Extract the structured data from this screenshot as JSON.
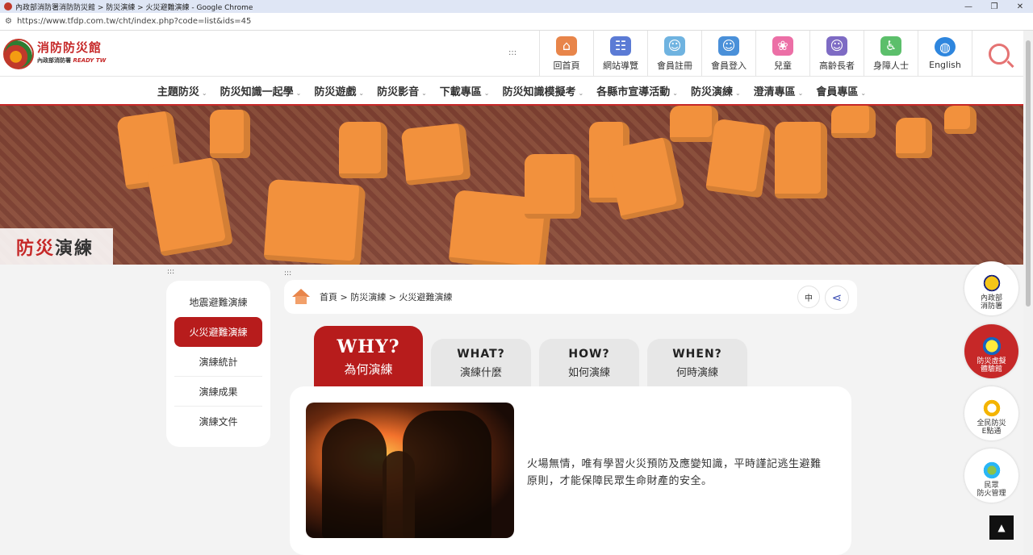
{
  "browser": {
    "window_title": "內政部消防署消防防災館 > 防災演練 > 火災避難演練 - Google Chrome",
    "url": "https://www.tfdp.com.tw/cht/index.php?code=list&ids=45",
    "controls": {
      "minimize": "—",
      "restore": "❐",
      "close": "✕"
    }
  },
  "site": {
    "logo_name": "消防防災館",
    "logo_sub": "內政部消防署",
    "logo_tag": "READY TW",
    "accessibility_mark": ":::"
  },
  "topnav": [
    {
      "label": "回首頁",
      "icon": "home-icon",
      "color": "#e8854a",
      "glyph": "⌂"
    },
    {
      "label": "網站導覽",
      "icon": "sitemap-icon",
      "color": "#5b7bd5",
      "glyph": "☷"
    },
    {
      "label": "會員註冊",
      "icon": "register-icon",
      "color": "#6fb3e0",
      "glyph": "☺"
    },
    {
      "label": "會員登入",
      "icon": "login-icon",
      "color": "#4a90d9",
      "glyph": "☺"
    },
    {
      "label": "兒童",
      "icon": "bear-icon",
      "color": "#ec6fa6",
      "glyph": "❀"
    },
    {
      "label": "高齡長者",
      "icon": "elder-icon",
      "color": "#7e6bc4",
      "glyph": "☺"
    },
    {
      "label": "身障人士",
      "icon": "wheelchair-icon",
      "color": "#5cbf6b",
      "glyph": "♿"
    },
    {
      "label": "English",
      "icon": "globe-icon",
      "color": "#2e86de",
      "glyph": "◍"
    }
  ],
  "mainmenu": [
    "主題防災",
    "防災知識一起學",
    "防災遊戲",
    "防災影音",
    "下載專區",
    "防災知識模擬考",
    "各縣市宣導活動",
    "防災演練",
    "澄清專區",
    "會員專區"
  ],
  "banner": {
    "title_red": "防災",
    "title_dark": "演練"
  },
  "sidebar": {
    "mark": ":::",
    "items": [
      "地震避難演練",
      "火災避難演練",
      "演練統計",
      "演練成果",
      "演練文件"
    ],
    "active_index": 1
  },
  "breadcrumb": {
    "mark": ":::",
    "path": "首頁 > 防災演練 > 火災避難演練",
    "lang_label": "中"
  },
  "tabs": [
    {
      "en": "WHY?",
      "zh": "為何演練"
    },
    {
      "en": "WHAT?",
      "zh": "演練什麼"
    },
    {
      "en": "HOW?",
      "zh": "如何演練"
    },
    {
      "en": "WHEN?",
      "zh": "何時演練"
    }
  ],
  "content": {
    "text": "火場無情，唯有學習火災預防及應變知識，平時謹記逃生避難原則，才能保障民眾生命財產的安全。"
  },
  "floating": [
    {
      "label": "內政部\n消防署",
      "icon": "nfa-emblem-icon"
    },
    {
      "label": "防災虛擬\n體驗館",
      "icon": "vr-hall-icon"
    },
    {
      "label": "全民防災\nE點通",
      "icon": "e-point-icon"
    },
    {
      "label": "民眾\n防火管理",
      "icon": "fire-management-icon"
    }
  ],
  "totop": "▲"
}
